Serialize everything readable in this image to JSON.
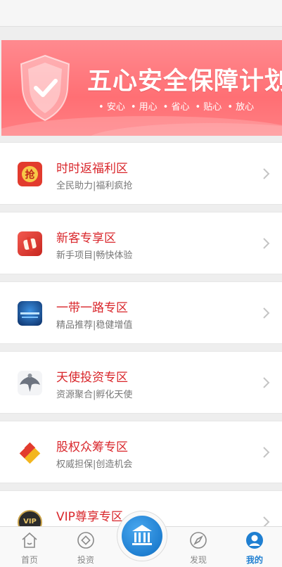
{
  "banner": {
    "title": "五心安全保障计划",
    "tags": [
      "安心",
      "用心",
      "省心",
      "贴心",
      "放心"
    ]
  },
  "zones": [
    {
      "title": "时时返福利区",
      "subtitle": "全民助力|福利疯抢",
      "icon": "grab-red-envelope-icon",
      "icon_text": "抢"
    },
    {
      "title": "新客专享区",
      "subtitle": "新手项目|畅快体验",
      "icon": "new-user-gift-icon"
    },
    {
      "title": "一带一路专区",
      "subtitle": "精品推荐|稳健增值",
      "icon": "belt-and-road-icon"
    },
    {
      "title": "天使投资专区",
      "subtitle": "资源聚合|孵化天使",
      "icon": "angel-wings-icon"
    },
    {
      "title": "股权众筹专区",
      "subtitle": "权威担保|创造机会",
      "icon": "equity-crowdfunding-icon"
    },
    {
      "title": "VIP尊享专区",
      "subtitle": "",
      "icon": "vip-badge-icon",
      "icon_text": "VIP"
    }
  ],
  "tabbar": {
    "home": "首页",
    "invest": "投资",
    "discover": "发现",
    "mine": "我的"
  },
  "colors": {
    "accent": "#1f7fd1",
    "title_red": "#d9262b",
    "banner": "#ff6f74"
  }
}
